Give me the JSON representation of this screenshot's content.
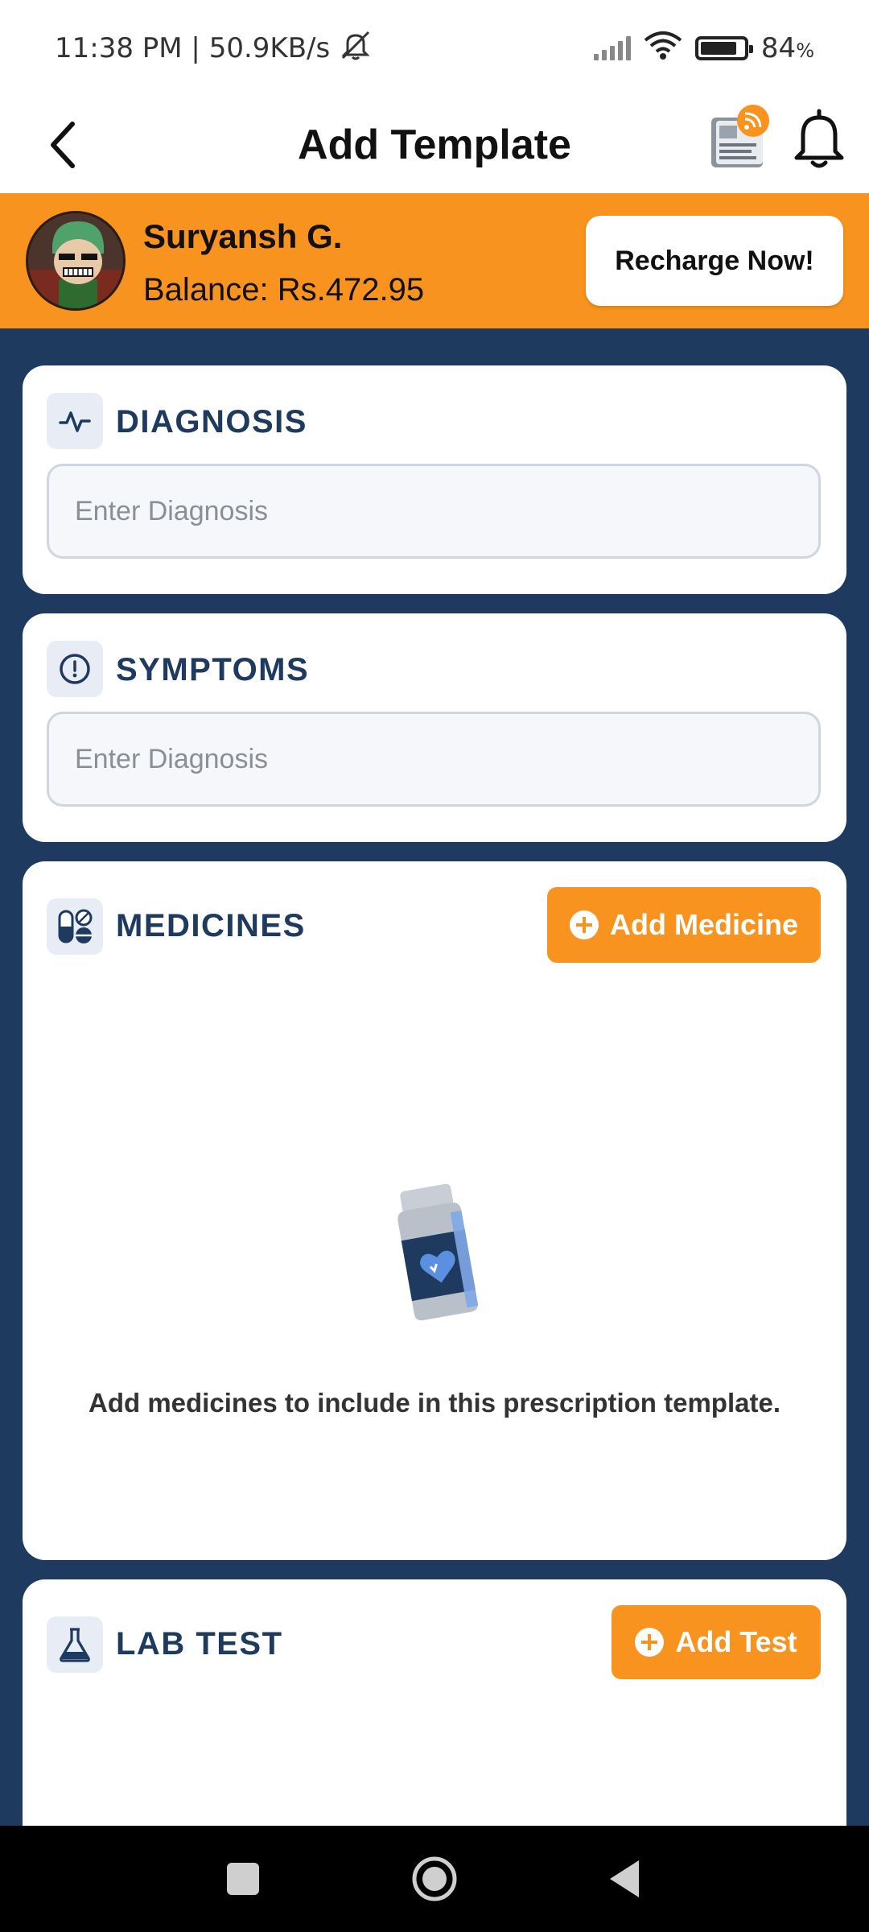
{
  "status_bar": {
    "time_speed": "11:38 PM | 50.9KB/s",
    "battery": "84",
    "battery_unit": "%",
    "battery_level": 0.84,
    "icons": [
      "alarm-off-icon",
      "signal-icon",
      "wifi-icon",
      "battery-icon"
    ]
  },
  "header": {
    "title": "Add Template",
    "icons": [
      "back-icon",
      "news-feed-icon",
      "bell-icon"
    ]
  },
  "user": {
    "name": "Suryansh G.",
    "balance": "Balance: Rs.472.95",
    "recharge_label": "Recharge Now!"
  },
  "diagnosis": {
    "title": "DIAGNOSIS",
    "placeholder": "Enter Diagnosis",
    "icon": "activity-icon"
  },
  "symptoms": {
    "title": "SYMPTOMS",
    "placeholder": "Enter Diagnosis",
    "icon": "alert-circle-icon"
  },
  "medicines": {
    "title": "MEDICINES",
    "add_label": "Add Medicine",
    "empty_message": "Add medicines to include in this prescription template.",
    "icon": "pills-icon"
  },
  "lab_test": {
    "title": "LAB TEST",
    "add_label": "Add Test",
    "icon": "flask-icon"
  },
  "colors": {
    "accent": "#f7931e",
    "primary": "#1e3a5f",
    "card": "#ffffff",
    "input_bg": "#f5f7fa"
  }
}
